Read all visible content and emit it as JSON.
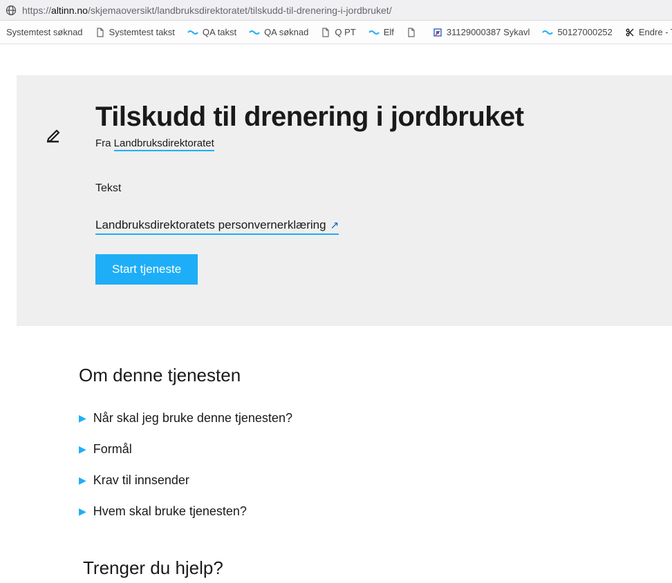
{
  "browser": {
    "url_display_pre": "https://",
    "url_display_host": "altinn.no",
    "url_display_path": "/skjemaoversikt/landbruksdirektoratet/tilskudd-til-drenering-i-jordbruket/"
  },
  "bookmarks": [
    {
      "icon": "page",
      "label": "Systemtest søknad"
    },
    {
      "icon": "page",
      "label": "Systemtest takst"
    },
    {
      "icon": "wave",
      "label": "QA takst"
    },
    {
      "icon": "wave",
      "label": "QA søknad"
    },
    {
      "icon": "page",
      "label": "Q PT"
    },
    {
      "icon": "wave",
      "label": "Elf"
    },
    {
      "icon": "page",
      "label": ""
    },
    {
      "icon": "square",
      "label": "31129000387 Sykavl"
    },
    {
      "icon": "wave",
      "label": "50127000252"
    },
    {
      "icon": "scissors",
      "label": "Endre - Test Agros"
    }
  ],
  "header": {
    "title": "Tilskudd til drenering i jordbruket",
    "from_prefix": "Fra ",
    "from_org": "Landbruksdirektoratet",
    "tekst_label": "Tekst",
    "privacy_link": "Landbruksdirektoratets personvernerklæring",
    "start_button": "Start tjeneste"
  },
  "about": {
    "heading": "Om denne tjenesten",
    "items": [
      "Når skal jeg bruke denne tjenesten?",
      "Formål",
      "Krav til innsender",
      "Hvem skal bruke tjenesten?"
    ],
    "help_heading": "Trenger du hjelp?"
  },
  "colors": {
    "accent": "#1eaef7",
    "panel_bg": "#efefef"
  }
}
